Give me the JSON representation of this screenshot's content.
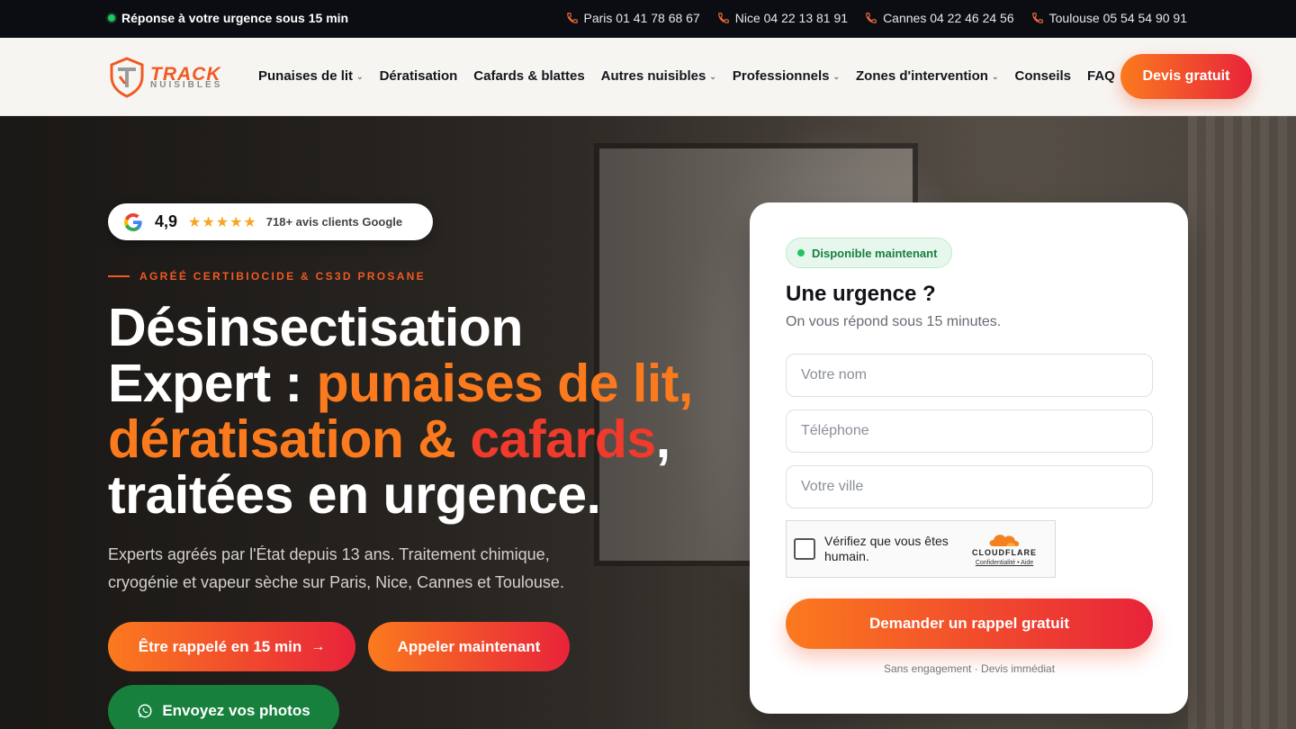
{
  "topbar": {
    "urgent_text": "Réponse à votre urgence sous 15 min",
    "phones": [
      {
        "label": "Paris 01 41 78 68 67"
      },
      {
        "label": "Nice 04 22 13 81 91"
      },
      {
        "label": "Cannes 04 22 46 24 56"
      },
      {
        "label": "Toulouse 05 54 54 90 91"
      }
    ]
  },
  "nav": {
    "logo_main": "TRACK",
    "logo_sub": "NUISIBLES",
    "items": [
      {
        "label": "Punaises de lit",
        "dropdown": true
      },
      {
        "label": "Dératisation",
        "dropdown": false
      },
      {
        "label": "Cafards & blattes",
        "dropdown": false
      },
      {
        "label": "Autres nuisibles",
        "dropdown": true
      },
      {
        "label": "Professionnels",
        "dropdown": true
      },
      {
        "label": "Zones d'intervention",
        "dropdown": true
      },
      {
        "label": "Conseils",
        "dropdown": false
      },
      {
        "label": "FAQ",
        "dropdown": false
      }
    ],
    "cta": "Devis gratuit"
  },
  "hero": {
    "rating": {
      "score": "4,9",
      "stars": "★★★★★",
      "text": "718+ avis clients Google"
    },
    "tagline": "AGRÉÉ CERTIBIOCIDE & CS3D PROSANE",
    "title_1": "Désinsectisation",
    "title_2a": "Expert : ",
    "title_2b": "punaises de lit,",
    "title_3a": "dératisation & ",
    "title_3b": "cafards",
    "title_3c": ",",
    "title_4": "traitées en urgence.",
    "subtitle": "Experts agréés par l'État depuis 13 ans. Traitement chimique, cryogénie et vapeur sèche sur Paris, Nice, Cannes et Toulouse.",
    "btn_callback": "Être rappelé en 15 min",
    "btn_call": "Appeler maintenant",
    "btn_whatsapp": "Envoyez vos photos"
  },
  "form": {
    "badge": "Disponible maintenant",
    "title": "Une urgence ?",
    "subtitle": "On vous répond sous 15 minutes.",
    "name_placeholder": "Votre nom",
    "phone_placeholder": "Téléphone",
    "city_placeholder": "Votre ville",
    "captcha_text": "Vérifiez que vous êtes humain.",
    "captcha_brand": "CLOUDFLARE",
    "captcha_links": "Confidentialité • Aide",
    "submit": "Demander un rappel gratuit",
    "fine_print": "Sans engagement · Devis immédiat"
  },
  "colors": {
    "accent_orange": "#fb7a1e",
    "accent_red": "#e8233a",
    "whatsapp_green": "#16803c",
    "available_green": "#22c55e"
  }
}
